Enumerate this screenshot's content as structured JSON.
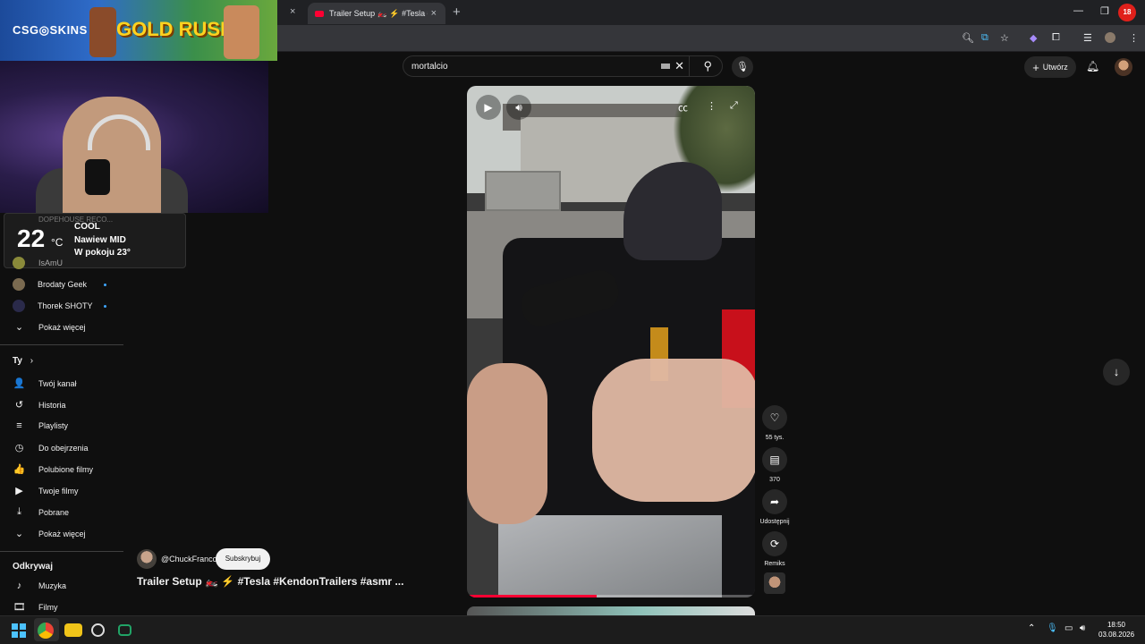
{
  "browser": {
    "active_tab_title": "Trailer Setup 🏍️ ⚡ #Tesla #Ken",
    "new_tab_icon": "+",
    "tab_close": "×",
    "window_controls": [
      "—",
      "❐",
      "✕"
    ],
    "notification_count": "18"
  },
  "overlay": {
    "brand": "CSG◎SKINS",
    "game": "GOLD RUSH",
    "weather": {
      "temp": "22",
      "unit": "°C",
      "line1": "COOL",
      "line2": "Nawiew MID",
      "line3": "W pokoju 23°"
    }
  },
  "sidebar": {
    "dim_subs": [
      "DOPEHOUSE RECO...",
      "IsAmU"
    ],
    "subs": [
      {
        "label": "Brodaty Geek"
      },
      {
        "label": "Thorek SHOTY"
      }
    ],
    "show_more_1": "Pokaż więcej",
    "you_header": "Ty",
    "you_items": [
      {
        "label": "Twój kanał",
        "icon": "👤"
      },
      {
        "label": "Historia",
        "icon": "↺"
      },
      {
        "label": "Playlisty",
        "icon": "≡"
      },
      {
        "label": "Do obejrzenia",
        "icon": "◷"
      },
      {
        "label": "Polubione filmy",
        "icon": "👍"
      },
      {
        "label": "Twoje filmy",
        "icon": "▶"
      },
      {
        "label": "Pobrane",
        "icon": "⤓"
      }
    ],
    "show_more_2": "Pokaż więcej",
    "explore_header": "Odkrywaj",
    "explore_items": [
      {
        "label": "Muzyka",
        "icon": "♪"
      },
      {
        "label": "Filmy",
        "icon": "🎞"
      }
    ]
  },
  "search": {
    "value": "mortalcio"
  },
  "header": {
    "create_label": "Utwórz"
  },
  "short": {
    "channel": "@ChuckFranco",
    "subscribe_label": "Subskrybuj",
    "title": "Trailer Setup 🏍️ ⚡ #Tesla #KendonTrailers #asmr ...",
    "progress": 0.45,
    "actions": {
      "likes": "55 tys.",
      "comments": "370",
      "share": "Udostępnij",
      "remix": "Remiks"
    }
  },
  "taskbar": {
    "time": "18:50",
    "date": "03.08.2026"
  },
  "colors": {
    "accent": "#ff0033",
    "background": "#0f0f0f"
  }
}
